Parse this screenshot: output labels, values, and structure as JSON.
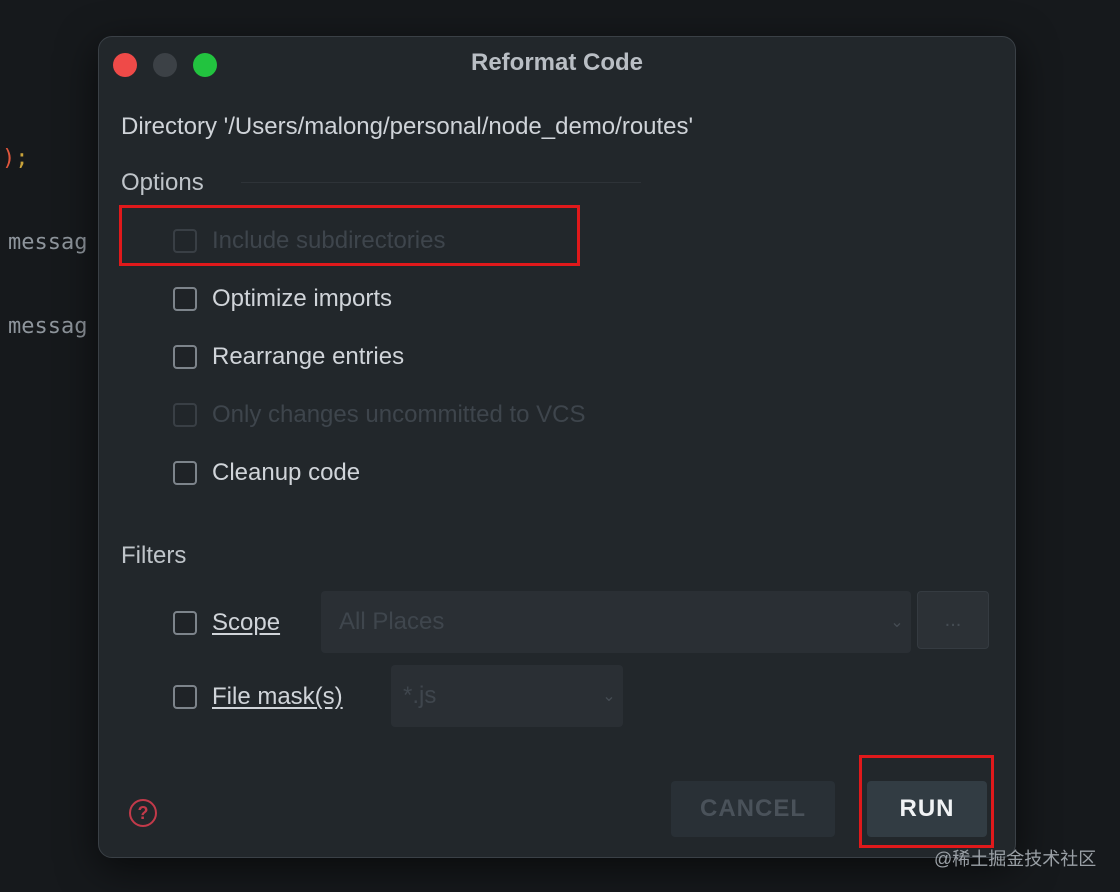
{
  "editor": {
    "code_lines": [
      "messag",
      "messag"
    ]
  },
  "dialog": {
    "title": "Reformat Code",
    "directory_text": "Directory '/Users/malong/personal/node_demo/routes'",
    "options_label": "Options",
    "options": [
      {
        "label": "Include subdirectories",
        "checked": false,
        "enabled": false
      },
      {
        "label": "Optimize imports",
        "checked": false,
        "enabled": true
      },
      {
        "label": "Rearrange entries",
        "checked": false,
        "enabled": true
      },
      {
        "label": "Only changes uncommitted to VCS",
        "checked": false,
        "enabled": false
      },
      {
        "label": "Cleanup code",
        "checked": false,
        "enabled": true
      }
    ],
    "filters_label": "Filters",
    "scope": {
      "label": "Scope",
      "checked": false,
      "value": "All Places",
      "more_label": "..."
    },
    "file_mask": {
      "label": "File mask(s)",
      "checked": false,
      "value": "*.js"
    },
    "help_icon": "question-circle-icon",
    "cancel_label": "CANCEL",
    "run_label": "RUN"
  },
  "colors": {
    "highlight": "#e0191b",
    "close": "#ef4a48",
    "maximize": "#22c33f"
  },
  "watermark": "@稀土掘金技术社区"
}
